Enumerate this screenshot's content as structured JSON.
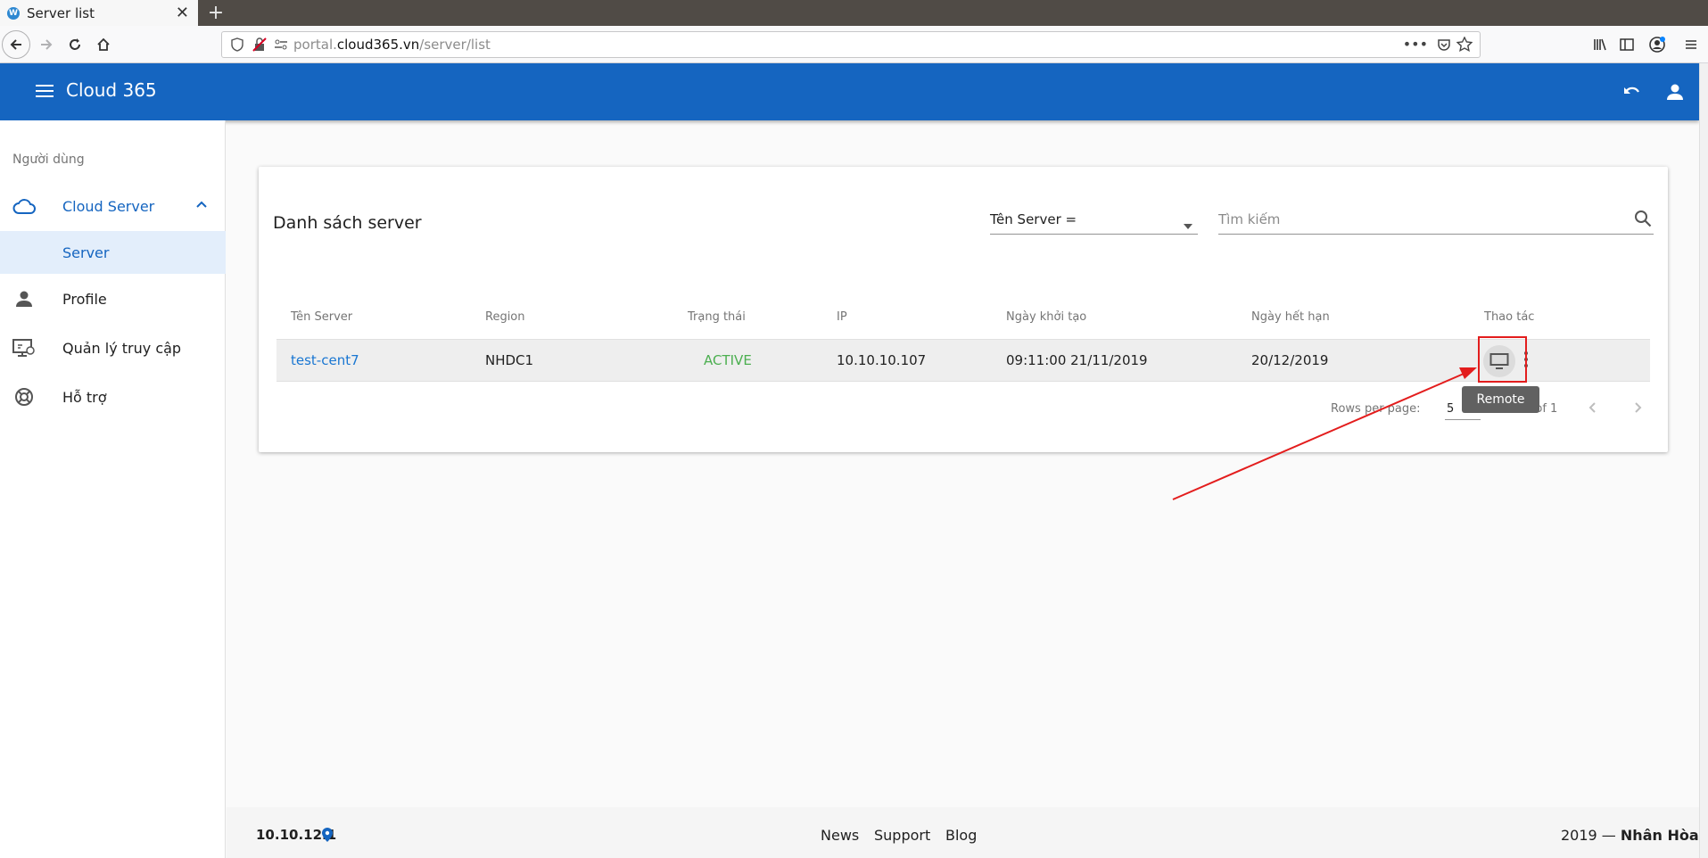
{
  "browser": {
    "tab_title": "Server list",
    "tab_favicon": "W",
    "url_prefix": "portal.",
    "url_domain": "cloud365.vn",
    "url_path": "/server/list"
  },
  "appbar": {
    "brand": "Cloud 365"
  },
  "sidebar": {
    "section_label": "Người dùng",
    "items": [
      {
        "label": "Cloud Server",
        "icon": "cloud-icon"
      },
      {
        "label": "Server"
      },
      {
        "label": "Profile",
        "icon": "person-icon"
      },
      {
        "label": "Quản lý truy cập",
        "icon": "access-monitor-icon"
      },
      {
        "label": "Hỗ trợ",
        "icon": "lifebuoy-icon"
      }
    ]
  },
  "card": {
    "title": "Danh sách server",
    "filter_select": "Tên Server =",
    "search_placeholder": "Tìm kiếm"
  },
  "table": {
    "headers": [
      "Tên Server",
      "Region",
      "Trạng thái",
      "IP",
      "Ngày khởi tạo",
      "Ngày hết hạn",
      "Thao tác"
    ],
    "rows": [
      {
        "name": "test-cent7",
        "region": "NHDC1",
        "status": "ACTIVE",
        "ip": "10.10.10.107",
        "created": "09:11:00 21/11/2019",
        "expires": "20/12/2019"
      }
    ],
    "status_color": "#4caf50"
  },
  "pagination": {
    "rows_per_page_label": "Rows per page:",
    "rows_per_page_value": "5",
    "range": "1-1 of 1"
  },
  "tooltip": {
    "text": "Remote"
  },
  "footer": {
    "ip": "10.10.12.1",
    "links": [
      "News",
      "Support",
      "Blog"
    ],
    "copyright_prefix": "2019 —",
    "copyright_brand": "Nhân Hòa"
  },
  "colors": {
    "primary": "#1565c0",
    "link": "#1976d2",
    "annotation": "#e31d1d"
  }
}
